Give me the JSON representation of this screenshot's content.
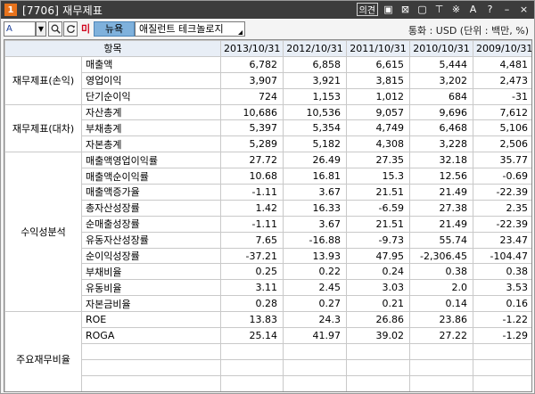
{
  "window": {
    "badge": "1",
    "title": "[7706] 재무제표",
    "icons": [
      {
        "name": "link-icon",
        "label": "의견"
      },
      {
        "name": "window-box-icon",
        "label": "▣"
      },
      {
        "name": "close-box-icon",
        "label": "⊠"
      },
      {
        "name": "copy-icon",
        "label": "▢"
      },
      {
        "name": "pin-icon",
        "label": "⊤"
      },
      {
        "name": "settings-icon",
        "label": "※"
      },
      {
        "name": "font-icon",
        "label": "A"
      },
      {
        "name": "help-icon",
        "label": "?"
      },
      {
        "name": "dash-icon",
        "label": "–"
      },
      {
        "name": "close-icon",
        "label": "×"
      }
    ]
  },
  "toolbar": {
    "code_value": "A",
    "mi_label": "미",
    "news_label": "뉴욕",
    "company_name": "애질런트 테크놀로지",
    "currency_text": "통화 : USD (단위 : 백만, %)"
  },
  "table": {
    "header_item": "항목",
    "years": [
      "2013/10/31",
      "2012/10/31",
      "2011/10/31",
      "2010/10/31",
      "2009/10/31"
    ],
    "groups": [
      {
        "category": "재무제표(손익)",
        "rows": [
          {
            "item": "매출액",
            "values": [
              "6,782",
              "6,858",
              "6,615",
              "5,444",
              "4,481"
            ]
          },
          {
            "item": "영업이익",
            "values": [
              "3,907",
              "3,921",
              "3,815",
              "3,202",
              "2,473"
            ]
          },
          {
            "item": "단기순이익",
            "values": [
              "724",
              "1,153",
              "1,012",
              "684",
              "-31"
            ]
          }
        ]
      },
      {
        "category": "재무제표(대차)",
        "rows": [
          {
            "item": "자산총계",
            "values": [
              "10,686",
              "10,536",
              "9,057",
              "9,696",
              "7,612"
            ]
          },
          {
            "item": "부채총계",
            "values": [
              "5,397",
              "5,354",
              "4,749",
              "6,468",
              "5,106"
            ]
          },
          {
            "item": "자본총계",
            "values": [
              "5,289",
              "5,182",
              "4,308",
              "3,228",
              "2,506"
            ]
          }
        ]
      },
      {
        "category": "수익성분석",
        "rows": [
          {
            "item": "매출액영업이익률",
            "values": [
              "27.72",
              "26.49",
              "27.35",
              "32.18",
              "35.77"
            ]
          },
          {
            "item": "매출액순이익률",
            "values": [
              "10.68",
              "16.81",
              "15.3",
              "12.56",
              "-0.69"
            ]
          },
          {
            "item": "매출액증가율",
            "values": [
              "-1.11",
              "3.67",
              "21.51",
              "21.49",
              "-22.39"
            ]
          },
          {
            "item": "총자산성장률",
            "values": [
              "1.42",
              "16.33",
              "-6.59",
              "27.38",
              "2.35"
            ]
          },
          {
            "item": "순매출성장률",
            "values": [
              "-1.11",
              "3.67",
              "21.51",
              "21.49",
              "-22.39"
            ]
          },
          {
            "item": "유동자산성장률",
            "values": [
              "7.65",
              "-16.88",
              "-9.73",
              "55.74",
              "23.47"
            ]
          },
          {
            "item": "순이익성장률",
            "values": [
              "-37.21",
              "13.93",
              "47.95",
              "-2,306.45",
              "-104.47"
            ]
          },
          {
            "item": "부채비율",
            "values": [
              "0.25",
              "0.22",
              "0.24",
              "0.38",
              "0.38"
            ]
          },
          {
            "item": "유동비율",
            "values": [
              "3.11",
              "2.45",
              "3.03",
              "2.0",
              "3.53"
            ]
          },
          {
            "item": "자본금비율",
            "values": [
              "0.28",
              "0.27",
              "0.21",
              "0.14",
              "0.16"
            ]
          }
        ]
      },
      {
        "category": "주요재무비율",
        "rows": [
          {
            "item": "ROE",
            "values": [
              "13.83",
              "24.3",
              "26.86",
              "23.86",
              "-1.22"
            ]
          },
          {
            "item": "ROGA",
            "values": [
              "25.14",
              "41.97",
              "39.02",
              "27.22",
              "-1.29"
            ]
          },
          {
            "item": "",
            "values": [
              "",
              "",
              "",
              "",
              ""
            ]
          },
          {
            "item": "",
            "values": [
              "",
              "",
              "",
              "",
              ""
            ]
          },
          {
            "item": "",
            "values": [
              "",
              "",
              "",
              "",
              ""
            ]
          },
          {
            "item": "",
            "values": [
              "",
              "",
              "",
              "",
              ""
            ]
          }
        ]
      }
    ]
  },
  "colors": {
    "titlebar": "#3c3c3c",
    "badge": "#e8731c",
    "news_button": "#7fb1dc",
    "mi_text": "#d0021b",
    "header_bg": "#e8eef6",
    "grid_line": "#c9c9c9"
  }
}
